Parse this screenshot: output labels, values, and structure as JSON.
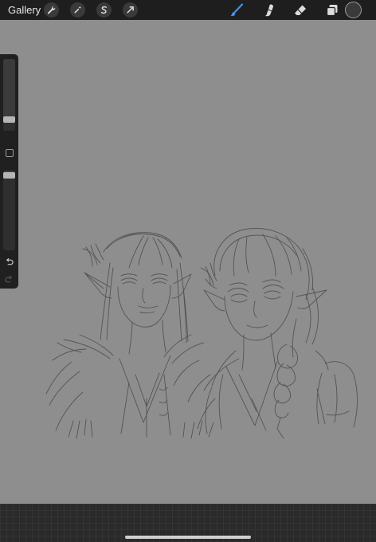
{
  "toolbar": {
    "gallery_label": "Gallery",
    "left_tools": [
      "wrench-icon",
      "magic-wand-icon",
      "selection-s-icon",
      "transform-arrow-icon"
    ],
    "right_tools": [
      "brush-icon",
      "smudge-icon",
      "eraser-icon",
      "layers-icon"
    ],
    "active_tool": "brush-icon",
    "current_color": "#3a3a3a"
  },
  "colors": {
    "toolbar_bg": "#1e1e1e",
    "canvas_bg": "#8e8e8e",
    "accent_blue": "#4a8fe6",
    "sketch_line": "#4e4e4e"
  },
  "sidebar": {
    "brush_size_level": 0.2,
    "opacity_level": 0.95,
    "icons": [
      "modify-square-icon",
      "undo-icon",
      "redo-icon"
    ]
  }
}
